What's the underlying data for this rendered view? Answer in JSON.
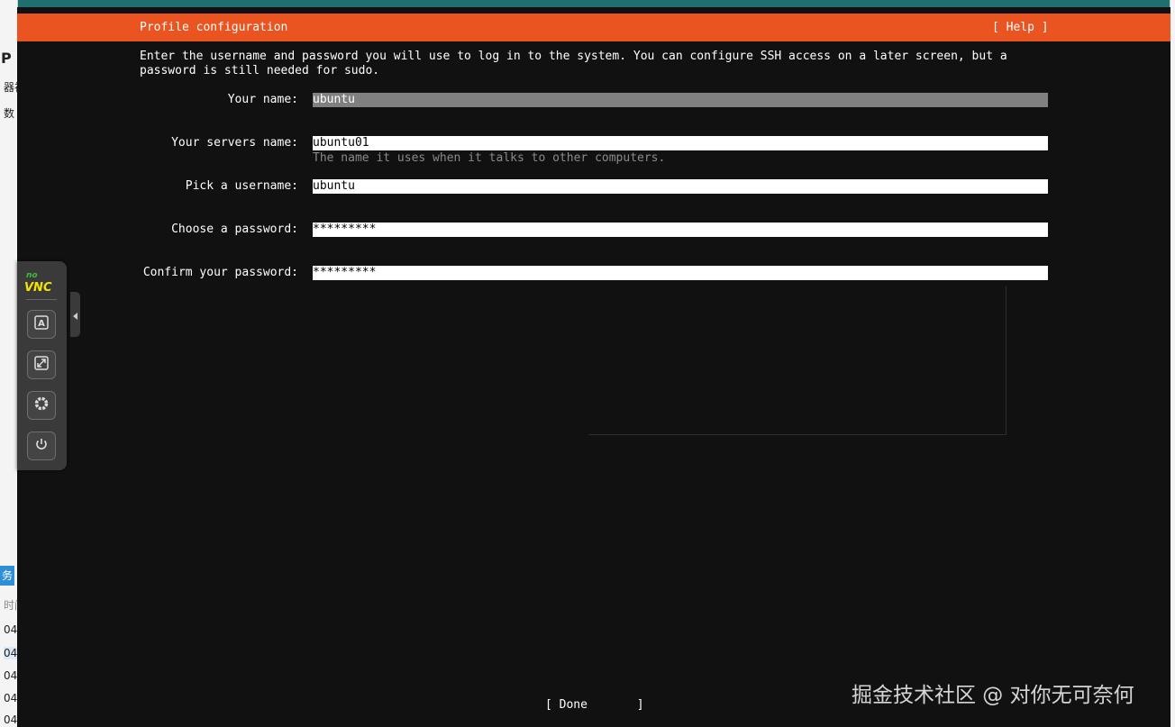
{
  "window": {
    "title": "Profile configuration",
    "help_label": "[ Help ]"
  },
  "intro_text": "Enter the username and password you will use to log in to the system. You can configure SSH access on a later screen, but a password is still needed for sudo.",
  "form": {
    "your_name": {
      "label": "Your name:",
      "value": "ubuntu"
    },
    "servers_name": {
      "label": "Your servers name:",
      "value": "ubuntu01",
      "hint": "The name it uses when it talks to other computers."
    },
    "username": {
      "label": "Pick a username:",
      "value": "ubuntu"
    },
    "password": {
      "label": "Choose a password:",
      "value": "*********"
    },
    "confirm_password": {
      "label": "Confirm your password:",
      "value": "*********"
    }
  },
  "done_label": "[ Done       ]",
  "watermark": "掘金技术社区 @ 对你无可奈何",
  "vnc": {
    "logo_top": "no",
    "logo_main": "VNC",
    "buttons": [
      "keyboard-icon",
      "fullscreen-icon",
      "settings-icon",
      "power-icon"
    ]
  },
  "host_fragments": [
    "P",
    "器视",
    "数",
    "务",
    "时间",
    "04",
    "04",
    "04",
    "04",
    "04"
  ],
  "colors": {
    "titlebar": "#e95420",
    "screen_bg": "#111111",
    "field_bg": "#ffffff",
    "active_field_bg": "#808080"
  }
}
